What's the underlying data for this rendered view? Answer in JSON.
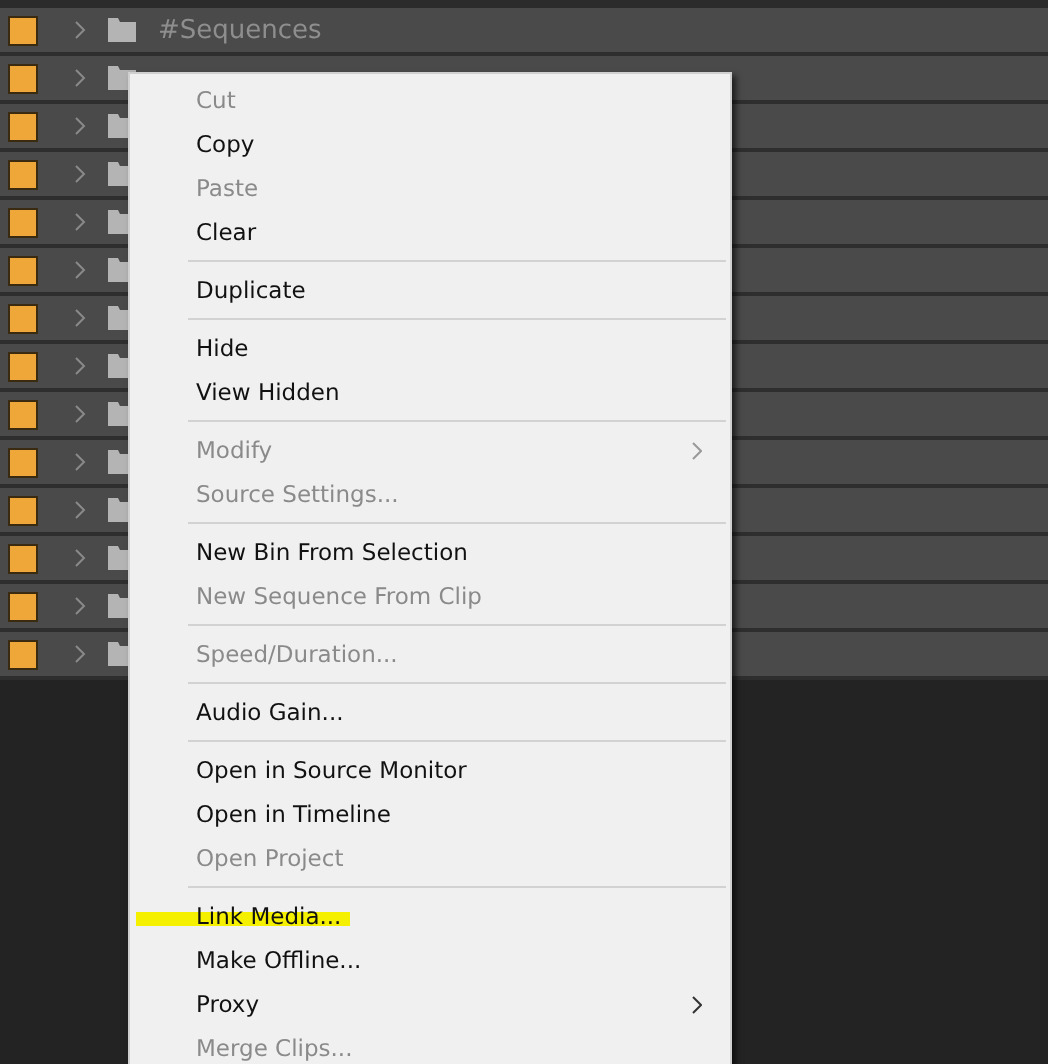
{
  "bins": [
    {
      "label": "#Sequences",
      "expanded": false
    },
    {
      "expanded": false
    },
    {
      "expanded": false
    },
    {
      "expanded": false
    },
    {
      "expanded": false
    },
    {
      "expanded": false
    },
    {
      "expanded": false
    },
    {
      "expanded": false
    },
    {
      "expanded": false
    },
    {
      "expanded": false
    },
    {
      "expanded": false
    },
    {
      "expanded": false
    },
    {
      "expanded": false
    },
    {
      "expanded": false
    }
  ],
  "context_menu": {
    "items": [
      {
        "kind": "item",
        "label": "Cut",
        "disabled": true
      },
      {
        "kind": "item",
        "label": "Copy",
        "disabled": false
      },
      {
        "kind": "item",
        "label": "Paste",
        "disabled": true
      },
      {
        "kind": "item",
        "label": "Clear",
        "disabled": false
      },
      {
        "kind": "separator"
      },
      {
        "kind": "item",
        "label": "Duplicate",
        "disabled": false
      },
      {
        "kind": "separator"
      },
      {
        "kind": "item",
        "label": "Hide",
        "disabled": false
      },
      {
        "kind": "item",
        "label": "View Hidden",
        "disabled": false
      },
      {
        "kind": "separator"
      },
      {
        "kind": "item",
        "label": "Modify",
        "disabled": true,
        "submenu": true
      },
      {
        "kind": "item",
        "label": "Source Settings...",
        "disabled": true
      },
      {
        "kind": "separator"
      },
      {
        "kind": "item",
        "label": "New Bin From Selection",
        "disabled": false
      },
      {
        "kind": "item",
        "label": "New Sequence From Clip",
        "disabled": true
      },
      {
        "kind": "separator"
      },
      {
        "kind": "item",
        "label": "Speed/Duration...",
        "disabled": true
      },
      {
        "kind": "separator"
      },
      {
        "kind": "item",
        "label": "Audio Gain...",
        "disabled": false
      },
      {
        "kind": "separator"
      },
      {
        "kind": "item",
        "label": "Open in Source Monitor",
        "disabled": false
      },
      {
        "kind": "item",
        "label": "Open in Timeline",
        "disabled": false
      },
      {
        "kind": "item",
        "label": "Open Project",
        "disabled": true
      },
      {
        "kind": "separator"
      },
      {
        "kind": "item",
        "label": "Link Media...",
        "disabled": false,
        "highlighted": true
      },
      {
        "kind": "item",
        "label": "Make Offline...",
        "disabled": false
      },
      {
        "kind": "item",
        "label": "Proxy",
        "disabled": false,
        "submenu": true
      },
      {
        "kind": "item",
        "label": "Merge Clips...",
        "disabled": true
      }
    ]
  }
}
